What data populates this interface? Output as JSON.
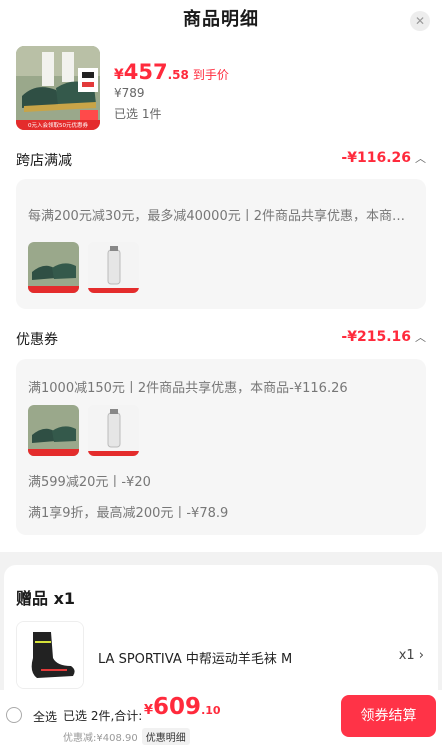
{
  "header": {
    "title": "商品明细"
  },
  "product": {
    "price_symbol": "¥",
    "price_int": "457",
    "price_dec": ".58",
    "price_tag": "到手价",
    "original_price": "¥789",
    "selected_count": "已选 1件",
    "thumb_banner": "0元入会领取50元优惠券",
    "thumb_badge": "限时特惠"
  },
  "cross_store": {
    "title": "跨店满减",
    "amount": "-¥116.26",
    "rule": "每满200元减30元，最多减40000元丨2件商品共享优惠，本商品-¥116.26"
  },
  "coupons": {
    "title": "优惠券",
    "amount": "-¥215.16",
    "rule1": "满1000减150元丨2件商品共享优惠，本商品-¥116.26",
    "rule2": "满599减20元丨-¥20",
    "rule3": "满1享9折，最高减200元丨-¥78.9"
  },
  "gift": {
    "title": "赠品 x1",
    "name": "LA SPORTIVA 中帮运动羊毛袜 M",
    "qty": "x1"
  },
  "bottom": {
    "select_all": "全选",
    "summary_prefix": "已选 2件,合计:",
    "total_symbol": "¥",
    "total_int": "609",
    "total_dec": ".10",
    "discount": "优惠减:¥408.90",
    "detail_label": "优惠明细",
    "checkout": "领券结算"
  },
  "colors": {
    "accent": "#ff2a3c",
    "button": "#ff3347"
  },
  "icons": [
    "close-icon",
    "chevron-up-icon",
    "chevron-right-icon",
    "radio-unchecked-icon"
  ]
}
